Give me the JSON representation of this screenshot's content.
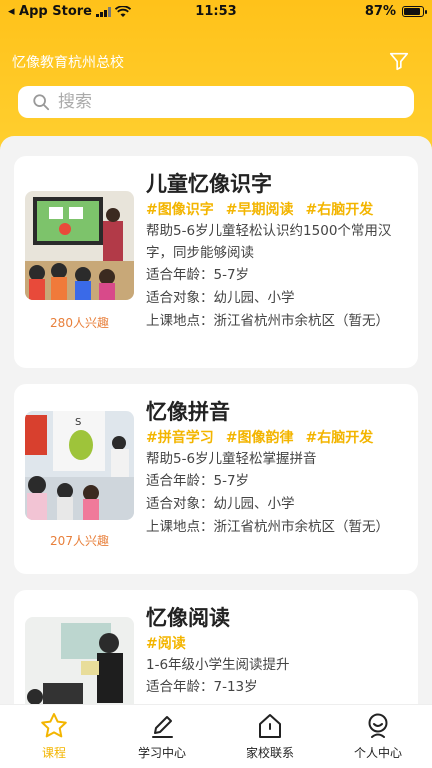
{
  "status_bar": {
    "carrier": "◂ App Store",
    "time": "11:53",
    "battery": "87%",
    "battery_level": 0.87
  },
  "header": {
    "title": "忆像教育杭州总校",
    "filter_icon": "filter-icon"
  },
  "search": {
    "placeholder": "搜索"
  },
  "courses": [
    {
      "title": "儿童忆像识字",
      "tags": [
        "#图像识字",
        "#早期阅读",
        "#右脑开发"
      ],
      "description": "帮助5-6岁儿童轻松认识约1500个常用汉字，同步能够阅读",
      "age": "适合年龄：5-7岁",
      "audience": "适合对象：幼儿园、小学",
      "location": "上课地点：浙江省杭州市余杭区（暂无）",
      "interest": "280人兴趣"
    },
    {
      "title": "忆像拼音",
      "tags": [
        "#拼音学习",
        "#图像韵律",
        "#右脑开发"
      ],
      "description": "帮助5-6岁儿童轻松掌握拼音",
      "age": "适合年龄：5-7岁",
      "audience": "适合对象：幼儿园、小学",
      "location": "上课地点：浙江省杭州市余杭区（暂无）",
      "interest": "207人兴趣"
    },
    {
      "title": "忆像阅读",
      "tags": [
        "#阅读"
      ],
      "description": "1-6年级小学生阅读提升",
      "age": "适合年龄：7-13岁",
      "audience": "",
      "location": "",
      "interest": ""
    }
  ],
  "tabbar": {
    "items": [
      {
        "label": "课程",
        "icon": "star-icon",
        "active": true
      },
      {
        "label": "学习中心",
        "icon": "pencil-icon",
        "active": false
      },
      {
        "label": "家校联系",
        "icon": "home-icon",
        "active": false
      },
      {
        "label": "个人中心",
        "icon": "person-icon",
        "active": false
      }
    ]
  },
  "colors": {
    "accent": "#ffc21a",
    "tag": "#f3b500",
    "interest": "#e8803c"
  }
}
